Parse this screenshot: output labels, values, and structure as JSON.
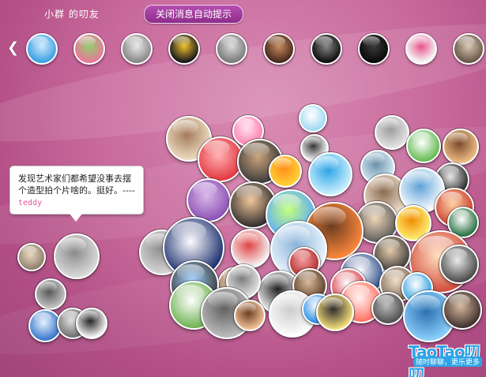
{
  "header": {
    "title": "小群 的叨友",
    "close_button_label": "关闭消息自动提示",
    "prev_arrow": "❮",
    "next_arrow": "❯"
  },
  "top_friends": [
    {
      "name": "friend-1",
      "colors": [
        "#3fa2e3",
        "#cfeaff"
      ]
    },
    {
      "name": "friend-2",
      "colors": [
        "#e87a9a",
        "#8fcf6a"
      ]
    },
    {
      "name": "friend-3",
      "colors": [
        "#8a8a8a",
        "#e9e9e9"
      ]
    },
    {
      "name": "friend-4",
      "colors": [
        "#1b1b1b",
        "#f2c12e"
      ]
    },
    {
      "name": "friend-5",
      "colors": [
        "#7d7d7d",
        "#dcdcdc"
      ]
    },
    {
      "name": "friend-6",
      "colors": [
        "#4a2b1e",
        "#c98c5e"
      ]
    },
    {
      "name": "friend-7",
      "colors": [
        "#111111",
        "#888888"
      ]
    },
    {
      "name": "friend-8",
      "colors": [
        "#0a0a0a",
        "#3b3b3b"
      ]
    },
    {
      "name": "friend-9",
      "colors": [
        "#f4f4f4",
        "#e94f8a"
      ]
    },
    {
      "name": "friend-10",
      "colors": [
        "#6b5a4b",
        "#d9c9b5"
      ]
    }
  ],
  "message_bubble": {
    "text": "发现艺术家们都希望没事去摆个造型拍个片啥的。挺好。----",
    "author": "teddy"
  },
  "bubble_avatars": [
    {
      "colors": [
        "#9ad7f0",
        "#ffffff"
      ]
    },
    {
      "colors": [
        "#ff7fb0",
        "#ffe0ec"
      ]
    },
    {
      "colors": [
        "#e7e7e7",
        "#9c9c9c"
      ]
    },
    {
      "colors": [
        "#f0dfc6",
        "#a47a5a"
      ]
    },
    {
      "colors": [
        "#ffffff",
        "#333333"
      ]
    },
    {
      "colors": [
        "#f3c28a",
        "#7a4a2a"
      ]
    },
    {
      "colors": [
        "#e2353f",
        "#ffb3b3"
      ]
    },
    {
      "colors": [
        "#5db84a",
        "#ffffff"
      ]
    },
    {
      "colors": [
        "#d8ecf7",
        "#6a8fa8"
      ]
    },
    {
      "colors": [
        "#3a3a3a",
        "#c9a27a"
      ]
    },
    {
      "colors": [
        "#ffd53a",
        "#ff8c1a"
      ]
    },
    {
      "colors": [
        "#d0f2ff",
        "#2da4e6"
      ]
    },
    {
      "colors": [
        "#222222",
        "#e9e9e9"
      ]
    },
    {
      "colors": [
        "#8b4fb3",
        "#d9b7ea"
      ]
    },
    {
      "colors": [
        "#f0e0d0",
        "#8a6a50"
      ]
    },
    {
      "colors": [
        "#ffffff",
        "#5aa0d8"
      ]
    },
    {
      "colors": [
        "#c93b2e",
        "#ffd2a0"
      ]
    },
    {
      "colors": [
        "#2a2a2a",
        "#f1c59a"
      ]
    },
    {
      "colors": [
        "#5aa8ff",
        "#c5ff7a"
      ]
    },
    {
      "colors": [
        "#5a5a5a",
        "#f0d6b8"
      ]
    },
    {
      "colors": [
        "#ff8a3d",
        "#6b3b1e"
      ]
    },
    {
      "colors": [
        "#fff176",
        "#f08c00"
      ]
    },
    {
      "colors": [
        "#1f6b3a",
        "#ffffff"
      ]
    },
    {
      "colors": [
        "#d7d7d7",
        "#8f8f8f"
      ]
    },
    {
      "colors": [
        "#f5f5f5",
        "#e04040"
      ]
    },
    {
      "colors": [
        "#162a6b",
        "#ffffff"
      ]
    },
    {
      "colors": [
        "#d24a3a",
        "#ffe0c0"
      ]
    },
    {
      "colors": [
        "#3c3c3c",
        "#e7caa8"
      ]
    },
    {
      "colors": [
        "#eef7ff",
        "#8ab4d8"
      ]
    },
    {
      "colors": [
        "#b12a2a",
        "#f4a0a0"
      ]
    },
    {
      "colors": [
        "#2e4d8a",
        "#ffffff"
      ]
    },
    {
      "colors": [
        "#7d6a58",
        "#f0dfc8"
      ]
    },
    {
      "colors": [
        "#ffffff",
        "#1d1d1d"
      ]
    },
    {
      "colors": [
        "#9c8069",
        "#f2d6b5"
      ]
    },
    {
      "colors": [
        "#3a3a3a",
        "#9fd0ff"
      ]
    },
    {
      "colors": [
        "#e6e6e6",
        "#7a7a7a"
      ]
    },
    {
      "colors": [
        "#5a3e2b",
        "#d9b896"
      ]
    },
    {
      "colors": [
        "#d73c4a",
        "#ffffff"
      ]
    },
    {
      "colors": [
        "#2fa0e0",
        "#ffffff"
      ]
    },
    {
      "colors": [
        "#444444",
        "#eaeaea"
      ]
    },
    {
      "colors": [
        "#6ab04c",
        "#ffffff"
      ]
    },
    {
      "colors": [
        "#c0c0c0",
        "#606060"
      ]
    },
    {
      "colors": [
        "#f7c8a0",
        "#6b3b1e"
      ]
    },
    {
      "colors": [
        "#ffffff",
        "#cccccc"
      ]
    },
    {
      "colors": [
        "#1e88e5",
        "#ffffff"
      ]
    },
    {
      "colors": [
        "#ff6f61",
        "#fff2ee"
      ]
    },
    {
      "colors": [
        "#4b4b4b",
        "#bcbcbc"
      ]
    },
    {
      "colors": [
        "#8fd3ff",
        "#2b6fb0"
      ]
    },
    {
      "colors": [
        "#3a2c2c",
        "#d6b89b"
      ]
    },
    {
      "colors": [
        "#ffe680",
        "#2b2b2b"
      ]
    }
  ],
  "left_cluster_avatars": [
    {
      "colors": [
        "#8a7a6a",
        "#e9d9c0"
      ]
    },
    {
      "colors": [
        "#dddddd",
        "#8a8a8a"
      ]
    },
    {
      "colors": [
        "#c9c9c9",
        "#555555"
      ]
    },
    {
      "colors": [
        "#2e70c9",
        "#e6f1ff"
      ]
    },
    {
      "colors": [
        "#6a6a6a",
        "#e0e0e0"
      ]
    },
    {
      "colors": [
        "#ffffff",
        "#202020"
      ]
    }
  ],
  "logo": {
    "main": "TaoTao叨叨",
    "sub": "随时聊聊，更乐更多"
  }
}
